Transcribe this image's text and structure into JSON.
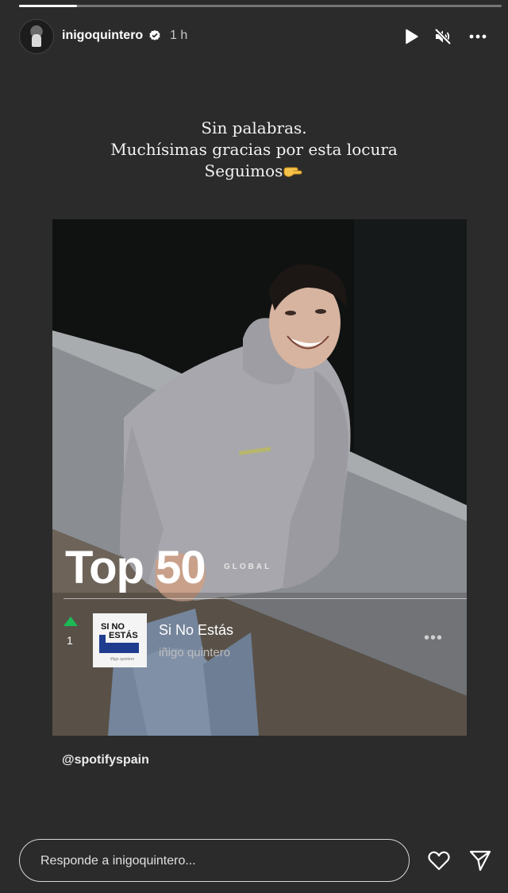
{
  "story": {
    "progress_fraction": 0.12
  },
  "header": {
    "username": "inigoquintero",
    "time": "1 h",
    "icons": [
      "play-icon",
      "mute-icon",
      "more-icon"
    ]
  },
  "caption": {
    "line1": "Sin palabras.",
    "line2": "Muchísimas gracias por esta locura",
    "line3": "Seguimos"
  },
  "card": {
    "title": "Top 50",
    "subtitle": "GLOBAL",
    "rank": "1",
    "track": {
      "title": "Si No Estás",
      "artist": "iñigo quintero",
      "cover_line1": "SI NO",
      "cover_line2": "ESTÁS",
      "cover_sub": "iñigo quintero"
    },
    "more_label": "•••",
    "colors": {
      "rank_up": "#1db954",
      "cover_blue": "#1f3c8f"
    }
  },
  "mention": "@spotifyspain",
  "footer": {
    "reply_placeholder": "Responde a inigoquintero..."
  }
}
